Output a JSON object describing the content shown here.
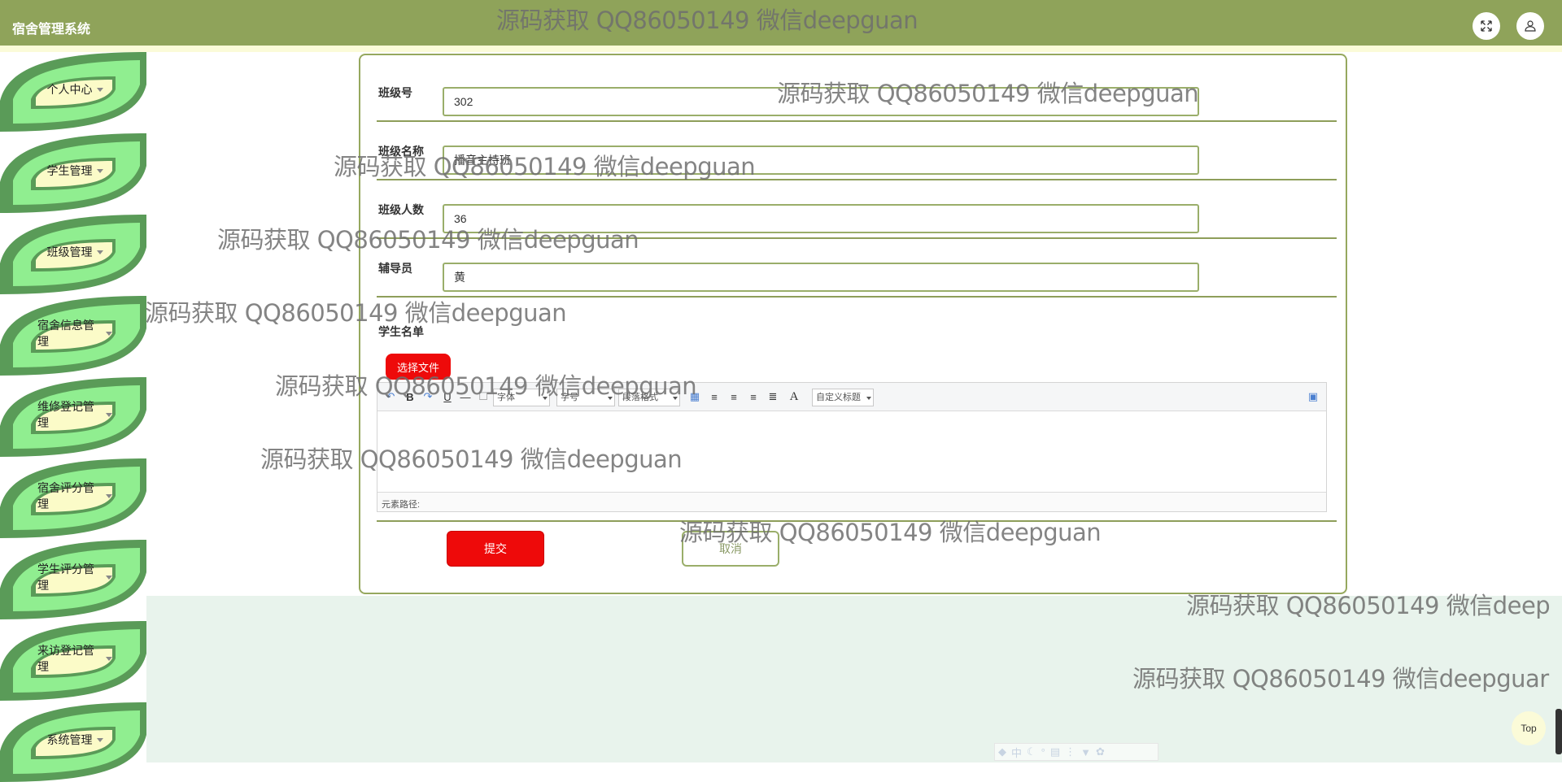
{
  "header": {
    "title": "宿舍管理系统",
    "fullscreen_icon": "expand-icon",
    "user_icon": "user-icon"
  },
  "watermark": "源码获取 QQ86050149 微信deepguan",
  "watermark_partial_1": "源码获取 QQ86050149 微信deep",
  "watermark_partial_2": "源码获取 QQ86050149 微信deepguar",
  "sidebar": {
    "items": [
      {
        "label": "个人中心"
      },
      {
        "label": "学生管理"
      },
      {
        "label": "班级管理"
      },
      {
        "label": "宿舍信息管理"
      },
      {
        "label": "维修登记管理"
      },
      {
        "label": "宿舍评分管理"
      },
      {
        "label": "学生评分管理"
      },
      {
        "label": "来访登记管理"
      },
      {
        "label": "系统管理"
      }
    ]
  },
  "form": {
    "class_no_label": "班级号",
    "class_no_value": "302",
    "class_name_label": "班级名称",
    "class_name_value": "播音主持班",
    "class_size_label": "班级人数",
    "class_size_value": "36",
    "counselor_label": "辅导员",
    "counselor_value": "黄",
    "student_list_label": "学生名单",
    "upload_button": "选择文件",
    "editor": {
      "font_select": "字体",
      "size_select": "字号",
      "paragraph_select": "段落格式",
      "custom_title_select": "自定义标题",
      "path_label": "元素路径:"
    },
    "submit_button": "提交",
    "cancel_button": "取消"
  },
  "back_to_top": "Top",
  "colors": {
    "header_bg": "#8fa35a",
    "accent_red": "#ee0a0a",
    "border_green": "#96a85e",
    "leaf_dark": "#5a9b58",
    "leaf_light": "#90ee90",
    "leaf_fill": "#fbfbc8"
  }
}
